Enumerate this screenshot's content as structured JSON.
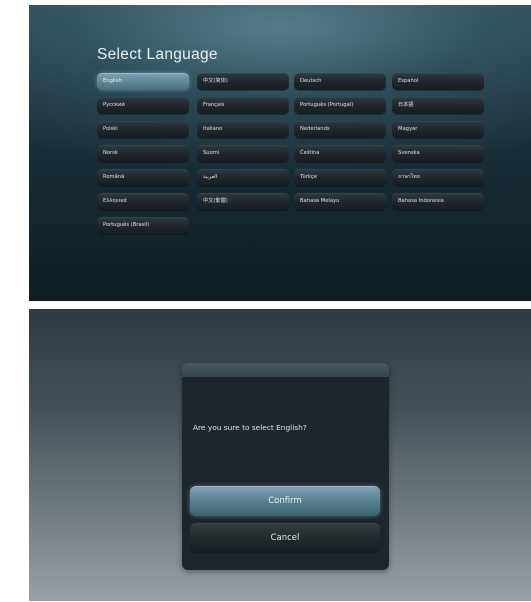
{
  "language_screen": {
    "title": "Select Language",
    "languages": [
      "English",
      "中文(简体)",
      "Deutsch",
      "Español",
      "Русский",
      "Français",
      "Português (Portugal)",
      "日本語",
      "Polski",
      "Italiano",
      "Nederlands",
      "Magyar",
      "Norsk",
      "Suomi",
      "Čeština",
      "Svenska",
      "Română",
      "العربية",
      "Türkçe",
      "ภาษาไทย",
      "Ελληνικά",
      "中文(繁體)",
      "Bahasa Melayu",
      "Bahasa Indonesia",
      "Português (Brasil)"
    ],
    "selected": "English"
  },
  "confirm_dialog": {
    "message": "Are you sure to select English?",
    "confirm_label": "Confirm",
    "cancel_label": "Cancel"
  }
}
